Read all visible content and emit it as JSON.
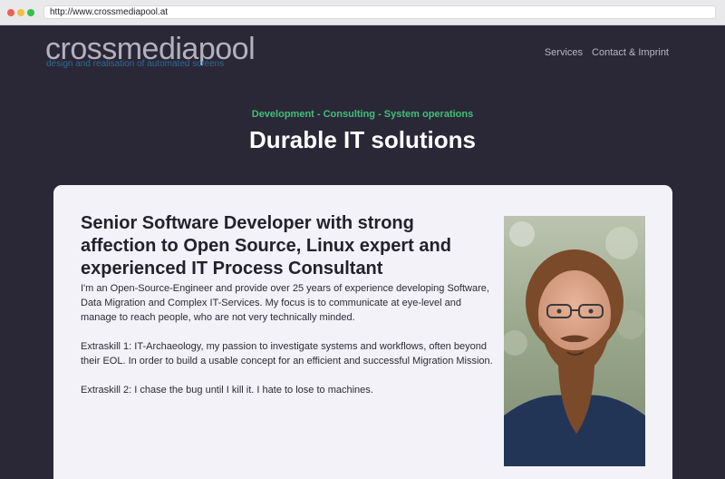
{
  "browser": {
    "url": "http://www.crossmediapool.at"
  },
  "header": {
    "logo": "crossmediapool",
    "tagline": "design and realisation of automated screens",
    "nav": [
      "Services",
      "Contact & Imprint"
    ]
  },
  "hero": {
    "kicker": "Development - Consulting - System operations",
    "title": "Durable IT solutions"
  },
  "card": {
    "heading": "Senior Software Developer with strong affection to Open Source, Linux expert and experienced IT Process Consultant",
    "paragraphs": [
      "I'm an Open-Source-Engineer and provide over 25 years of experience developing Software, Data Migration and Complex IT-Services. My focus is to communicate at eye-level and manage to reach people, who are not very technically minded.",
      "Extraskill 1: IT-Archaeology, my passion to investigate systems and workflows, often beyond their EOL. In order to build a usable concept for an efficient and successful Migration Mission.",
      "Extraskill 2: I chase the bug until I kill it. I hate to lose to machines."
    ]
  },
  "colors": {
    "page_background": "#2a2837",
    "card_background": "#f3f2f8",
    "accent_green": "#3fc07a",
    "tagline_blue": "#2f6b8f"
  }
}
